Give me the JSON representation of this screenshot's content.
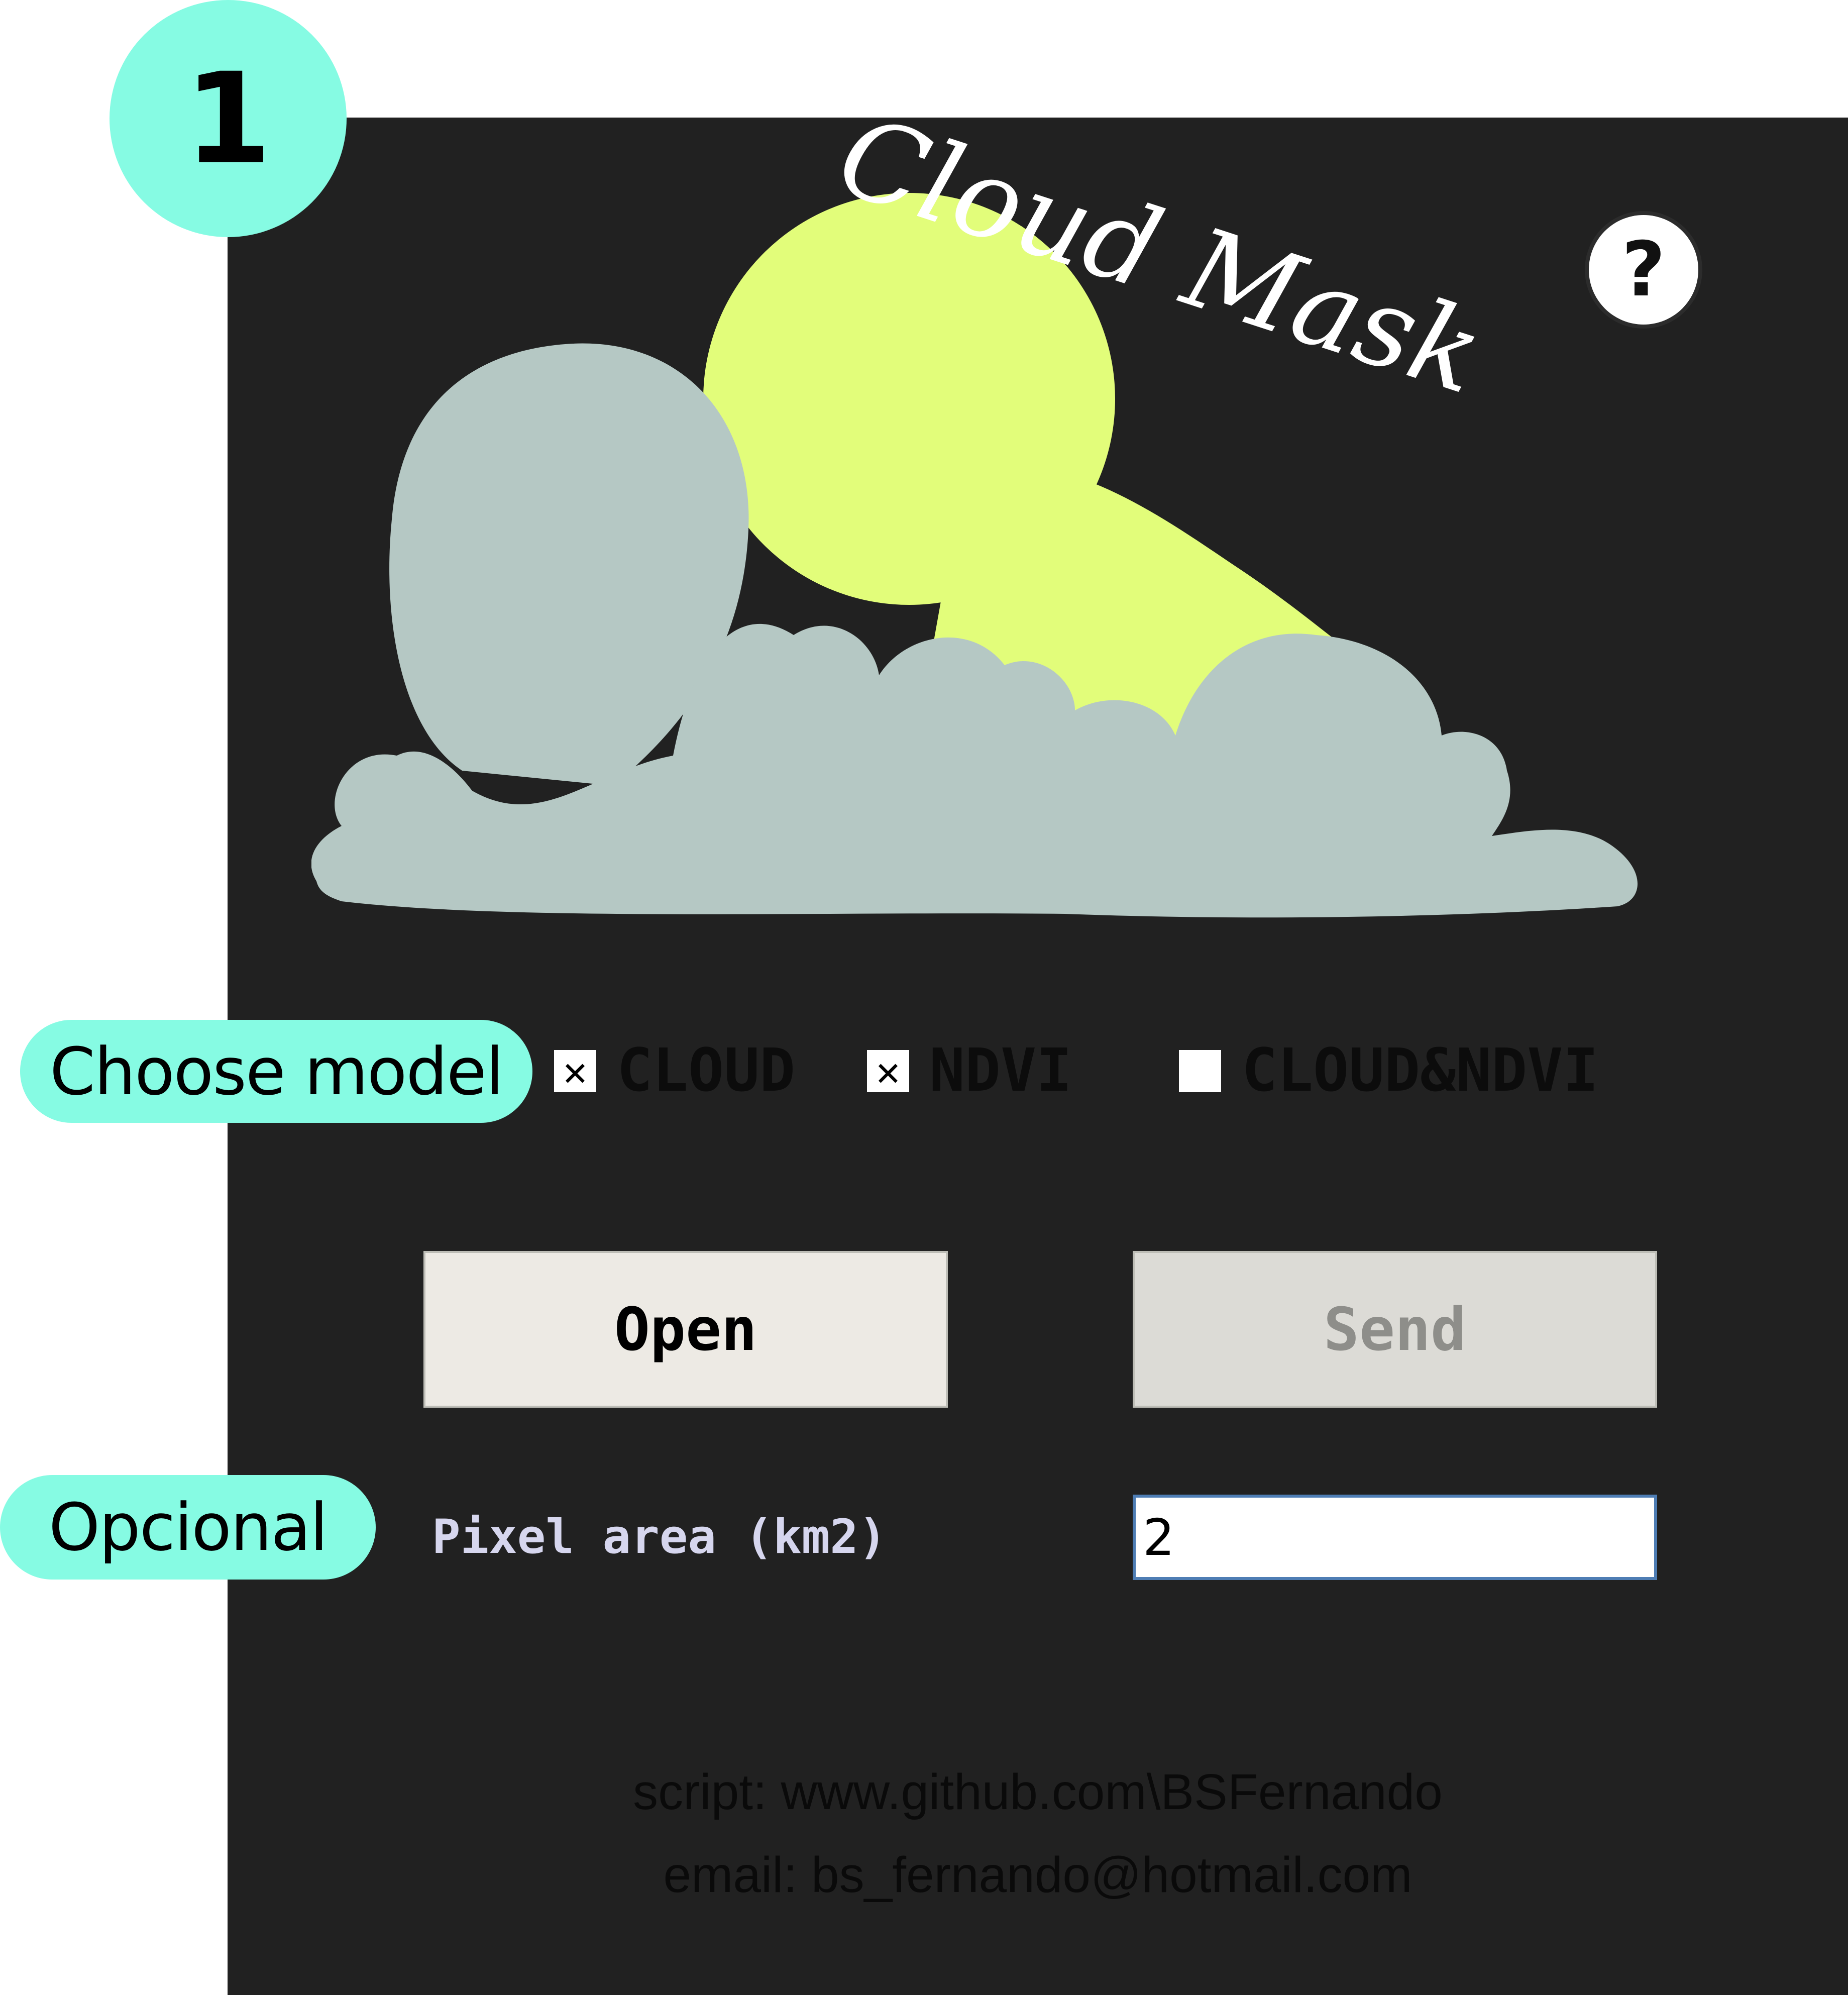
{
  "step": {
    "number": "1"
  },
  "annotations": {
    "choose_model": "Choose model",
    "optional": "Opcional"
  },
  "logo": {
    "text": "Cloud Mask",
    "sun_color": "#e2fd7a",
    "cloud_color": "#b5c8c4"
  },
  "help": {
    "symbol": "?"
  },
  "models": [
    {
      "label": "CLOUD",
      "checked": true,
      "mark": "✕"
    },
    {
      "label": "NDVI",
      "checked": true,
      "mark": "✕"
    },
    {
      "label": "CLOUD&NDVI",
      "checked": false,
      "mark": ""
    }
  ],
  "buttons": {
    "open": "Open",
    "send": "Send"
  },
  "pixel_area": {
    "label": "Pixel area (km2)",
    "value": "2"
  },
  "credits": {
    "script": "script: www.github.com\\BSFernando",
    "email": "email: bs_fernando@hotmail.com"
  }
}
